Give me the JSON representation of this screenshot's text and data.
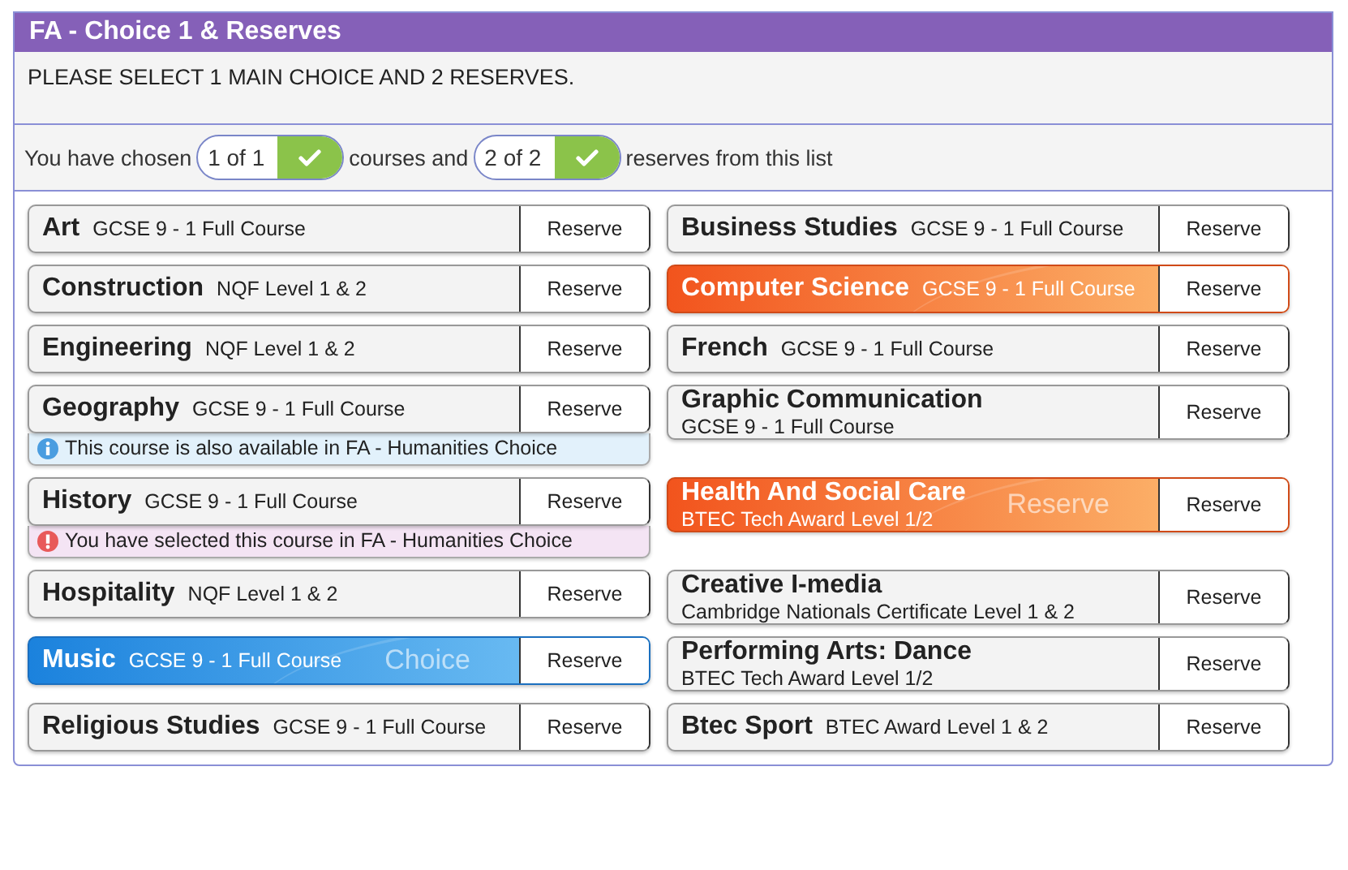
{
  "panel": {
    "title": "FA - Choice 1 & Reserves",
    "instruction": "PLEASE SELECT 1 MAIN CHOICE AND 2 RESERVES.",
    "summary": [
      {
        "kind": "text",
        "text": "You have chosen"
      },
      {
        "kind": "pill",
        "text": "1 of 1",
        "complete": true
      },
      {
        "kind": "text",
        "text": "courses and"
      },
      {
        "kind": "pill",
        "text": "2 of 2",
        "complete": true
      },
      {
        "kind": "text",
        "text": "reserves from this list"
      }
    ],
    "courses": [
      {
        "name": "Art",
        "qualification": "GCSE 9 - 1 Full Course",
        "stacked": false,
        "choice": false,
        "reserved": false,
        "button": "Reserve"
      },
      {
        "name": "Business Studies",
        "qualification": "GCSE 9 - 1 Full Course",
        "stacked": false,
        "choice": false,
        "reserved": false,
        "button": "Reserve"
      },
      {
        "name": "Construction",
        "qualification": "NQF Level 1 & 2",
        "stacked": false,
        "choice": false,
        "reserved": false,
        "button": "Reserve"
      },
      {
        "name": "Computer Science",
        "qualification": "GCSE 9 - 1 Full Course",
        "stacked": false,
        "choice": false,
        "reserved": true,
        "button": "Reserve"
      },
      {
        "name": "Engineering",
        "qualification": "NQF Level 1 & 2",
        "stacked": false,
        "choice": false,
        "reserved": false,
        "button": "Reserve"
      },
      {
        "name": "French",
        "qualification": "GCSE 9 - 1 Full Course",
        "stacked": false,
        "choice": false,
        "reserved": false,
        "button": "Reserve"
      },
      {
        "name": "Geography",
        "qualification": "GCSE 9 - 1 Full Course",
        "stacked": false,
        "choice": false,
        "reserved": false,
        "button": "Reserve",
        "note": {
          "kind": "info",
          "text": "This course is also available in FA - Humanities Choice"
        }
      },
      {
        "name": "Graphic Communication",
        "qualification": "GCSE 9 - 1 Full Course",
        "stacked": true,
        "choice": false,
        "reserved": false,
        "button": "Reserve"
      },
      {
        "name": "History",
        "qualification": "GCSE 9 - 1 Full Course",
        "stacked": false,
        "choice": false,
        "reserved": false,
        "button": "Reserve",
        "note": {
          "kind": "warning",
          "text": "You have selected this course in FA - Humanities Choice"
        }
      },
      {
        "name": "Health And Social Care",
        "qualification": "BTEC Tech Award Level 1/2",
        "stacked": true,
        "choice": false,
        "reserved": true,
        "button": "Reserve",
        "badge": "Reserve"
      },
      {
        "name": "Hospitality",
        "qualification": "NQF Level 1 & 2",
        "stacked": false,
        "choice": false,
        "reserved": false,
        "button": "Reserve"
      },
      {
        "name": "Creative I-media",
        "qualification": "Cambridge Nationals Certificate Level 1 & 2",
        "stacked": true,
        "choice": false,
        "reserved": false,
        "button": "Reserve"
      },
      {
        "name": "Music",
        "qualification": "GCSE 9 - 1 Full Course",
        "stacked": false,
        "choice": true,
        "reserved": false,
        "button": "Reserve",
        "badge": "Choice"
      },
      {
        "name": "Performing Arts: Dance",
        "qualification": "BTEC Tech Award Level 1/2",
        "stacked": true,
        "choice": false,
        "reserved": false,
        "button": "Reserve"
      },
      {
        "name": "Religious Studies",
        "qualification": "GCSE 9 - 1 Full Course",
        "stacked": false,
        "choice": false,
        "reserved": false,
        "button": "Reserve"
      },
      {
        "name": "Btec Sport",
        "qualification": "BTEC Award Level 1 & 2",
        "stacked": false,
        "choice": false,
        "reserved": false,
        "button": "Reserve"
      }
    ]
  }
}
